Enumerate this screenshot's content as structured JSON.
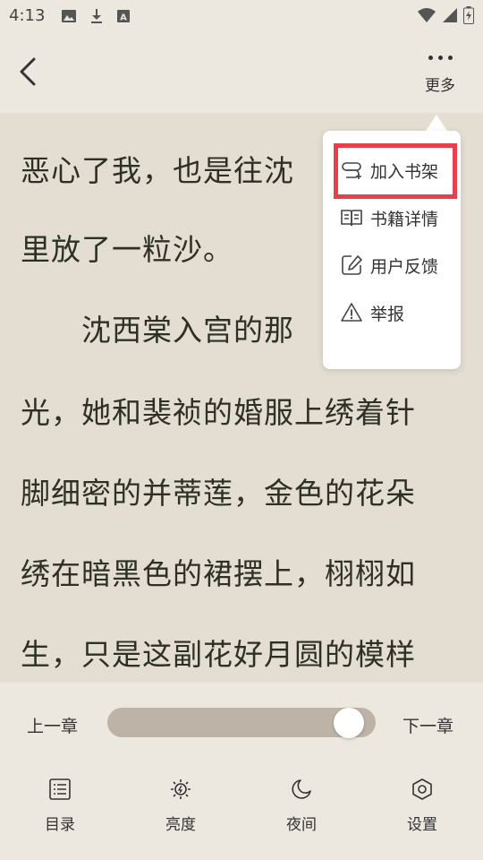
{
  "status_bar": {
    "time": "4:13",
    "icons_left": [
      "image-icon",
      "download-icon",
      "app-a-icon"
    ],
    "icons_right": [
      "wifi-icon",
      "signal-icon",
      "battery-icon"
    ]
  },
  "header": {
    "back_icon": "chevron-left-icon",
    "more_label": "更多"
  },
  "reader": {
    "lines": [
      "恶心了我，也是往沈",
      "里放了一粒沙。",
      "　　沈西棠入宫的那",
      "光，她和裴祯的婚服上绣着针",
      "脚细密的并蒂莲，金色的花朵",
      "绣在暗黑色的裙摆上，栩栩如",
      "生，只是这副花好月圆的模样"
    ]
  },
  "popup_menu": {
    "items": [
      {
        "label": "加入书架",
        "icon": "add-to-shelf-icon",
        "highlighted": true
      },
      {
        "label": "书籍详情",
        "icon": "book-details-icon",
        "highlighted": false
      },
      {
        "label": "用户反馈",
        "icon": "feedback-icon",
        "highlighted": false
      },
      {
        "label": "举报",
        "icon": "report-icon",
        "highlighted": false
      }
    ]
  },
  "chapter_nav": {
    "prev_label": "上一章",
    "next_label": "下一章",
    "progress": 0.95
  },
  "toolbar": {
    "items": [
      {
        "label": "目录",
        "icon": "catalog-icon"
      },
      {
        "label": "亮度",
        "icon": "brightness-icon"
      },
      {
        "label": "夜间",
        "icon": "night-mode-icon"
      },
      {
        "label": "设置",
        "icon": "settings-icon"
      }
    ]
  },
  "colors": {
    "background": "#ece7df",
    "reader_background": "#e3ddd2",
    "text": "#2e3026",
    "highlight": "#e8404a",
    "progress_track": "#bdb3a6"
  }
}
